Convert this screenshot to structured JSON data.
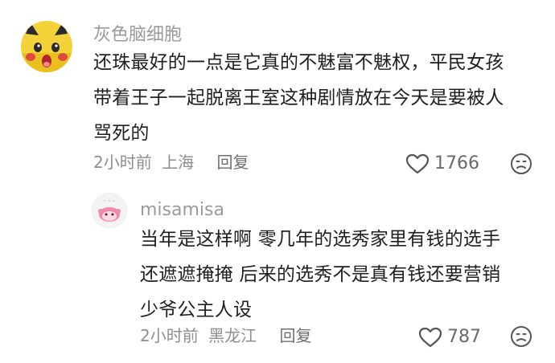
{
  "comments": [
    {
      "username": "灰色脑细胞",
      "lines": [
        "还珠最好的一点是它真的不魅富不魅权，平民女孩",
        "带着王子一起脱离王室这种剧情放在今天是要被人",
        "骂死的"
      ],
      "time": "2小时前",
      "location": "上海",
      "reply_label": "回复",
      "like_count": "1766",
      "avatar_icon": "pikachu-avatar",
      "avatar_bg": "#f4d23a"
    },
    {
      "username": "misamisa",
      "lines": [
        "当年是这样啊 零几年的选秀家里有钱的选手",
        "还遮遮掩掩 后来的选秀不是真有钱还要营销",
        "少爷公主人设"
      ],
      "time": "2小时前",
      "location": "黑龙江",
      "reply_label": "回复",
      "like_count": "787",
      "avatar_icon": "cartoon-avatar",
      "avatar_bg": "#f3f3f5"
    }
  ],
  "icons": {
    "like": "heart-outline-icon",
    "dislike": "frown-face-icon"
  }
}
